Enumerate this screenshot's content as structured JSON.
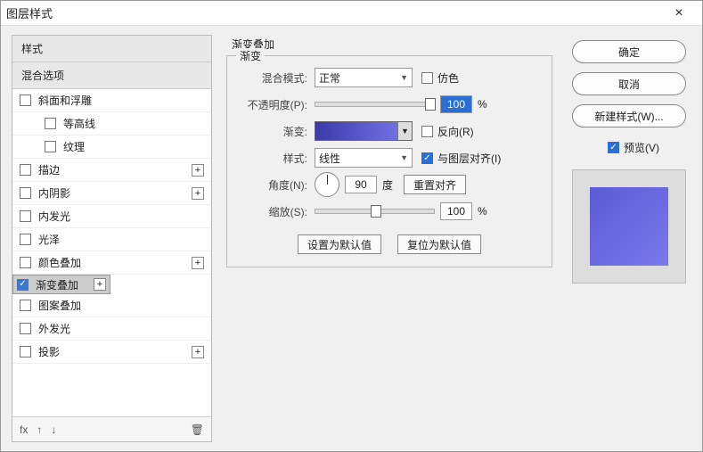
{
  "window": {
    "title": "图层样式",
    "close": "×"
  },
  "sidebar": {
    "header_styles": "样式",
    "header_blend": "混合选项",
    "items": [
      {
        "label": "斜面和浮雕",
        "checked": false,
        "plus": false,
        "sub": false
      },
      {
        "label": "等高线",
        "checked": false,
        "plus": false,
        "sub": true
      },
      {
        "label": "纹理",
        "checked": false,
        "plus": false,
        "sub": true
      },
      {
        "label": "描边",
        "checked": false,
        "plus": true,
        "sub": false
      },
      {
        "label": "内阴影",
        "checked": false,
        "plus": true,
        "sub": false
      },
      {
        "label": "内发光",
        "checked": false,
        "plus": false,
        "sub": false
      },
      {
        "label": "光泽",
        "checked": false,
        "plus": false,
        "sub": false
      },
      {
        "label": "颜色叠加",
        "checked": false,
        "plus": true,
        "sub": false
      },
      {
        "label": "渐变叠加",
        "checked": true,
        "plus": true,
        "sub": false,
        "selected": true
      },
      {
        "label": "图案叠加",
        "checked": false,
        "plus": false,
        "sub": false
      },
      {
        "label": "外发光",
        "checked": false,
        "plus": false,
        "sub": false
      },
      {
        "label": "投影",
        "checked": false,
        "plus": true,
        "sub": false
      }
    ],
    "footer": {
      "fx": "fx",
      "up": "↑",
      "down": "↓",
      "trash": "🗑"
    }
  },
  "panel": {
    "title": "渐变叠加",
    "group": "渐变",
    "blend_mode": {
      "label": "混合模式:",
      "value": "正常"
    },
    "dither": {
      "label": "仿色",
      "checked": false
    },
    "opacity": {
      "label": "不透明度(P):",
      "value": "100",
      "unit": "%",
      "pos": 100
    },
    "gradient": {
      "label": "渐变:"
    },
    "reverse": {
      "label": "反向(R)",
      "checked": false
    },
    "style": {
      "label": "样式:",
      "value": "线性"
    },
    "align": {
      "label": "与图层对齐(I)",
      "checked": true
    },
    "angle": {
      "label": "角度(N):",
      "value": "90",
      "unit": "度",
      "reset": "重置对齐"
    },
    "scale": {
      "label": "缩放(S):",
      "value": "100",
      "unit": "%",
      "pos": 50
    },
    "btn_default": "设置为默认值",
    "btn_reset": "复位为默认值"
  },
  "right": {
    "ok": "确定",
    "cancel": "取消",
    "new_style": "新建样式(W)...",
    "preview": {
      "label": "预览(V)",
      "checked": true
    }
  }
}
